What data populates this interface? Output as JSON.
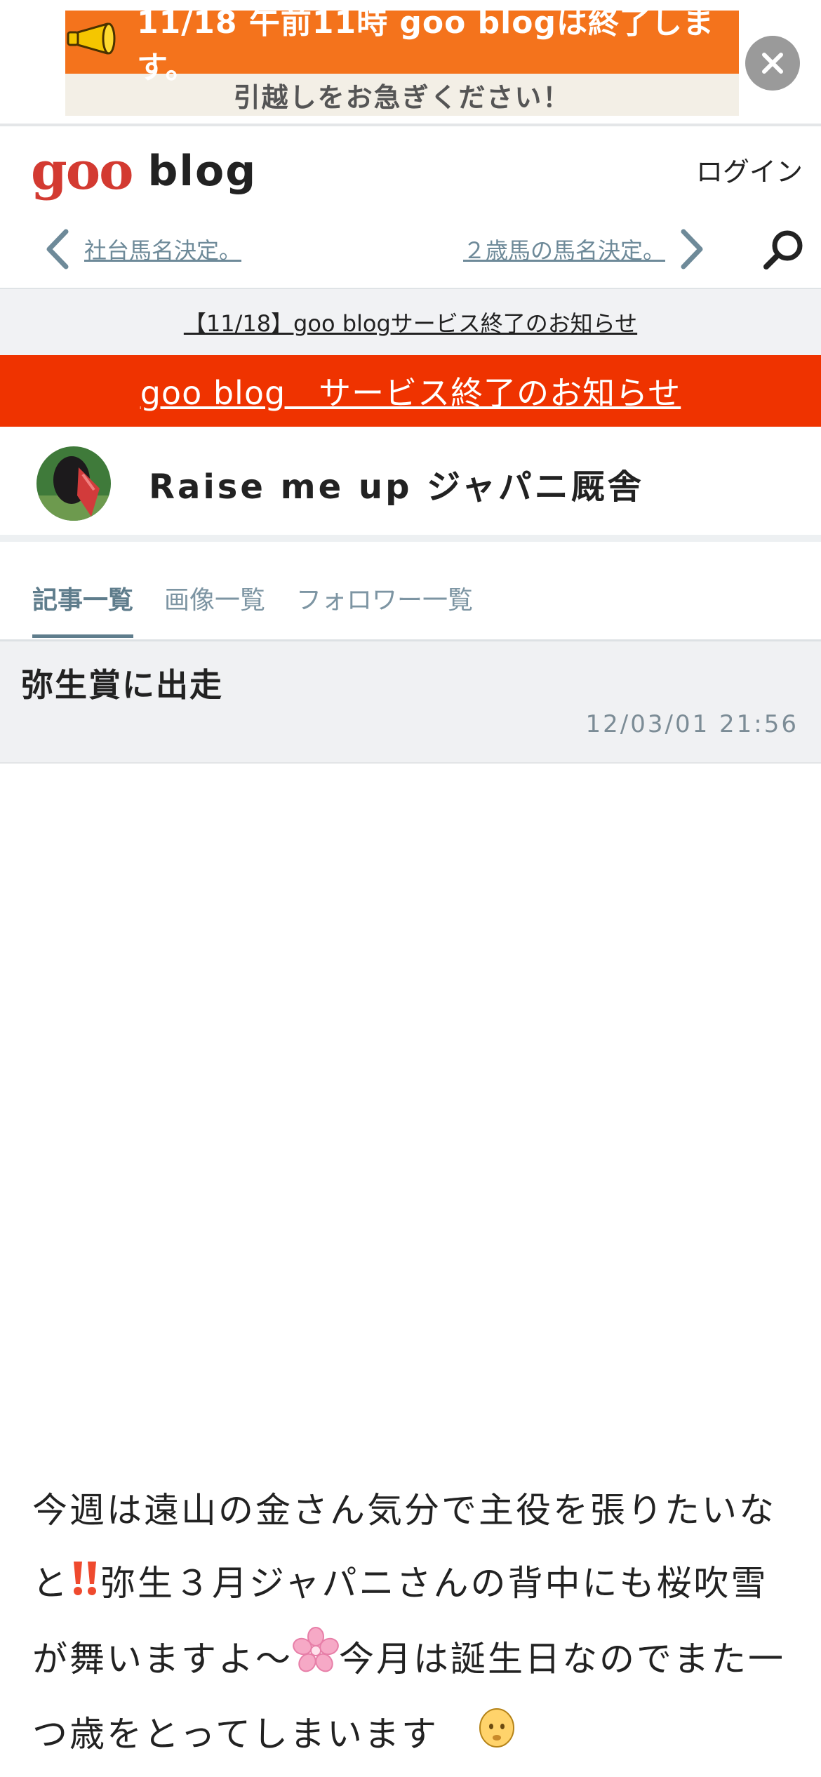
{
  "banner": {
    "line1": "11/18 午前11時 goo blogは終了します。",
    "line2": "引越しをお急ぎください！",
    "colors": {
      "top": "#f4731c",
      "bottom": "#f3efe6"
    }
  },
  "header": {
    "logo_goo": "goo",
    "logo_blog": "blog",
    "login_label": "ログイン",
    "prev_article": "社台馬名決定。",
    "next_article": "２歳馬の馬名決定。"
  },
  "notice": {
    "link_text": "【11/18】goo blogサービス終了のお知らせ",
    "red_bar_text": "goo blog　サービス終了のお知らせ",
    "red_color": "#ef3300"
  },
  "blog": {
    "title": "Raise me up ジャパニ厩舎"
  },
  "tabs": [
    {
      "label": "記事一覧",
      "active": true
    },
    {
      "label": "画像一覧",
      "active": false
    },
    {
      "label": "フォロワー一覧",
      "active": false
    }
  ],
  "entry": {
    "title": "弥生賞に出走",
    "date": "12/03/01 21:56",
    "body_part1": "今週は遠山の金さん気分で主役を張りたいなと",
    "body_part2": "弥生３月ジャパニさんの背中にも桜吹雪が舞いますよ〜",
    "body_part3": "今月は誕生日なのでまた一つ歳をとってしまいます　",
    "icons": [
      "double-exclamation-icon",
      "cherry-blossom-icon",
      "face-emoji-icon"
    ]
  }
}
